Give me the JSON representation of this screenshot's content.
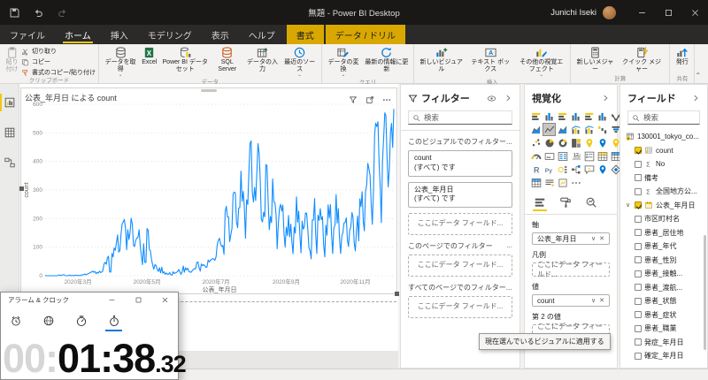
{
  "titlebar": {
    "title": "無題 - Power BI Desktop",
    "user_name": "Junichi Iseki"
  },
  "menu": {
    "tabs": [
      {
        "label": "ファイル"
      },
      {
        "label": "ホーム",
        "selected": true
      },
      {
        "label": "挿入"
      },
      {
        "label": "モデリング"
      },
      {
        "label": "表示"
      },
      {
        "label": "ヘルプ"
      },
      {
        "label": "書式",
        "contextual": true
      },
      {
        "label": "データ / ドリル",
        "contextual": true
      }
    ]
  },
  "ribbon": {
    "groups": [
      {
        "label": "クリップボード",
        "items": [
          {
            "label": "貼り付け",
            "icon": "paste",
            "size": "large",
            "disabled": true
          },
          {
            "label": "切り取り",
            "icon": "scissors",
            "size": "small"
          },
          {
            "label": "コピー",
            "icon": "copy",
            "size": "small"
          },
          {
            "label": "書式のコピー/貼り付け",
            "icon": "painter",
            "size": "small"
          }
        ]
      },
      {
        "label": "データ",
        "items": [
          {
            "label": "データを取得",
            "icon": "get-data",
            "size": "large",
            "dropdown": true
          },
          {
            "label": "Excel",
            "icon": "excel",
            "size": "large"
          },
          {
            "label": "Power BI データセット",
            "icon": "pbi-dataset",
            "size": "large"
          },
          {
            "label": "SQL Server",
            "icon": "sql-server",
            "size": "large"
          },
          {
            "label": "データの入力",
            "icon": "enter-data",
            "size": "large"
          },
          {
            "label": "最近のソース",
            "icon": "recent-sources",
            "size": "large",
            "dropdown": true
          }
        ]
      },
      {
        "label": "クエリ",
        "items": [
          {
            "label": "データの変換",
            "icon": "transform-data",
            "size": "large",
            "dropdown": true
          },
          {
            "label": "最新の情報に更新",
            "icon": "refresh",
            "size": "large"
          }
        ]
      },
      {
        "label": "挿入",
        "items": [
          {
            "label": "新しいビジュアル",
            "icon": "new-visual",
            "size": "large"
          },
          {
            "label": "テキスト ボックス",
            "icon": "text-box",
            "size": "large"
          },
          {
            "label": "その他の視覚エフェクト",
            "icon": "more-visuals",
            "size": "large",
            "dropdown": true
          }
        ]
      },
      {
        "label": "計算",
        "items": [
          {
            "label": "新しいメジャー",
            "icon": "new-measure",
            "size": "large"
          },
          {
            "label": "クイック メジャー",
            "icon": "quick-measure",
            "size": "large"
          }
        ]
      },
      {
        "label": "共有",
        "items": [
          {
            "label": "発行",
            "icon": "publish",
            "size": "large"
          }
        ]
      }
    ]
  },
  "view_sidebar": {
    "views": [
      {
        "name": "report-view",
        "selected": true
      },
      {
        "name": "data-view"
      },
      {
        "name": "model-view"
      }
    ]
  },
  "visual": {
    "title": "公表_年月日 による count"
  },
  "chart_data": {
    "type": "line",
    "title": "公表_年月日 による count",
    "xlabel": "公表_年月日",
    "ylabel": "count",
    "ylim": [
      0,
      600
    ],
    "y_ticks": [
      0,
      100,
      200,
      300,
      400,
      500,
      600
    ],
    "grid": "dotted-horizontal",
    "legend": "none",
    "start_date": "2020-02-01",
    "x_ticks": [
      {
        "day": 29,
        "label": "2020年3月"
      },
      {
        "day": 90,
        "label": "2020年5月"
      },
      {
        "day": 151,
        "label": "2020年7月"
      },
      {
        "day": 213,
        "label": "2020年9月"
      },
      {
        "day": 274,
        "label": "2020年11月"
      }
    ],
    "series": [
      {
        "name": "count",
        "color": "#118DFF",
        "values": [
          1,
          0,
          0,
          0,
          0,
          0,
          0,
          0,
          0,
          0,
          0,
          0,
          3,
          2,
          0,
          3,
          3,
          3,
          0,
          0,
          0,
          1,
          2,
          0,
          1,
          1,
          0,
          2,
          1,
          1,
          1,
          0,
          3,
          2,
          4,
          6,
          3,
          5,
          7,
          9,
          11,
          13,
          16,
          12,
          15,
          7,
          12,
          9,
          16,
          11,
          13,
          17,
          41,
          47,
          40,
          63,
          68,
          13,
          13,
          78,
          66,
          97,
          89,
          116,
          143,
          83,
          87,
          144,
          181,
          189,
          197,
          166,
          91,
          161,
          127,
          149,
          201,
          181,
          107,
          102,
          123,
          132,
          134,
          161,
          103,
          72,
          39,
          112,
          47,
          46,
          165,
          160,
          93,
          87,
          57,
          38,
          23,
          39,
          36,
          22,
          15,
          28,
          10,
          30,
          9,
          14,
          5,
          10,
          5,
          5,
          11,
          3,
          2,
          14,
          8,
          10,
          11,
          15,
          22,
          14,
          5,
          13,
          34,
          12,
          28,
          20,
          26,
          14,
          13,
          12,
          18,
          22,
          25,
          24,
          47,
          48,
          27,
          16,
          41,
          35,
          39,
          35,
          29,
          31,
          55,
          48,
          54,
          57,
          60,
          58,
          54,
          67,
          107,
          124,
          131,
          111,
          102,
          106,
          75,
          224,
          243,
          206,
          206,
          119,
          143,
          165,
          286,
          293,
          290,
          188,
          168,
          237,
          238,
          366,
          260,
          295,
          239,
          131,
          266,
          250,
          367,
          463,
          472,
          292,
          258,
          309,
          263,
          360,
          462,
          429,
          331,
          197,
          188,
          222,
          206,
          389,
          385,
          260,
          161,
          207,
          186,
          339,
          258,
          256,
          212,
          95,
          182,
          236,
          250,
          226,
          247,
          148,
          100,
          170,
          141,
          211,
          136,
          181,
          116,
          77,
          170,
          149,
          276,
          187,
          226,
          146,
          80,
          191,
          163,
          171,
          220,
          218,
          162,
          98,
          88,
          59,
          195,
          195,
          270,
          144,
          78,
          212,
          194,
          235,
          196,
          207,
          108,
          66,
          177,
          142,
          248,
          203,
          249,
          146,
          78,
          166,
          177,
          284,
          184,
          235,
          132,
          78,
          139,
          150,
          185,
          186,
          203,
          124,
          102,
          158,
          171,
          221,
          204,
          116,
          87,
          158,
          209,
          122,
          269,
          242,
          294,
          189,
          157,
          293,
          317,
          393,
          374,
          352,
          255,
          180,
          298,
          493,
          534,
          522,
          539,
          391,
          314,
          186,
          401,
          481,
          570,
          561,
          418,
          311,
          372,
          500,
          533,
          449,
          584
        ]
      }
    ]
  },
  "filters": {
    "header": "フィルター",
    "search_placeholder": "検索",
    "sections": [
      {
        "title": "このビジュアルでのフィルター...",
        "cards": [
          {
            "name": "count",
            "condition": "(すべて) です"
          },
          {
            "name": "公表_年月日",
            "condition": "(すべて) です"
          },
          {
            "placeholder": "ここにデータ フィールド..."
          }
        ]
      },
      {
        "title": "このページでのフィルター",
        "more": "...",
        "cards": [
          {
            "placeholder": "ここにデータ フィールド..."
          }
        ]
      },
      {
        "title": "すべてのページでのフィルター...",
        "cards": [
          {
            "placeholder": "ここにデータ フィールド..."
          }
        ]
      }
    ]
  },
  "visualizations": {
    "header": "視覚化",
    "icons": [
      {
        "name": "stacked-bar-chart"
      },
      {
        "name": "stacked-column-chart"
      },
      {
        "name": "clustered-bar-chart"
      },
      {
        "name": "clustered-column-chart"
      },
      {
        "name": "100-stacked-bar-chart"
      },
      {
        "name": "100-stacked-column-chart"
      },
      {
        "name": "ribbon-chart"
      },
      {
        "name": "area-chart"
      },
      {
        "name": "line-chart",
        "selected": true
      },
      {
        "name": "stacked-area-chart"
      },
      {
        "name": "line-and-stacked-column-chart"
      },
      {
        "name": "line-and-clustered-column-chart"
      },
      {
        "name": "waterfall-chart"
      },
      {
        "name": "funnel-chart"
      },
      {
        "name": "scatter-chart"
      },
      {
        "name": "pie-chart"
      },
      {
        "name": "donut-chart"
      },
      {
        "name": "treemap"
      },
      {
        "name": "map"
      },
      {
        "name": "filled-map"
      },
      {
        "name": "shape-map"
      },
      {
        "name": "gauge"
      },
      {
        "name": "card"
      },
      {
        "name": "multi-row-card"
      },
      {
        "name": "kpi"
      },
      {
        "name": "slicer"
      },
      {
        "name": "table"
      },
      {
        "name": "matrix"
      },
      {
        "name": "r-script-visual"
      },
      {
        "name": "python-visual"
      },
      {
        "name": "key-influencers"
      },
      {
        "name": "decomposition-tree"
      },
      {
        "name": "qa-visual"
      },
      {
        "name": "arcgis-map"
      },
      {
        "name": "power-apps"
      },
      {
        "name": "paginated-report"
      },
      {
        "name": "smart-narrative"
      },
      {
        "name": "custom-visual"
      },
      {
        "name": "more-visuals-ellipsis"
      }
    ],
    "tabs": [
      {
        "name": "fields-tab",
        "selected": true
      },
      {
        "name": "format-tab"
      },
      {
        "name": "analytics-tab"
      }
    ],
    "wells": [
      {
        "label": "軸",
        "value": "公表_年月日"
      },
      {
        "label": "凡例",
        "placeholder": "ここにデータ フィールド..."
      },
      {
        "label": "値",
        "value": "count"
      },
      {
        "label": "第 2 の値",
        "placeholder": "ここにデータ フィールド..."
      }
    ]
  },
  "fields_pane": {
    "header": "フィールド",
    "search_placeholder": "検索",
    "table": {
      "name": "130001_tokyo_co...",
      "icon": "table-check"
    },
    "fields": [
      {
        "name": "count",
        "checked": true,
        "icon": "grid"
      },
      {
        "name": "No",
        "icon": "sigma"
      },
      {
        "name": "備考"
      },
      {
        "name": "全国地方公...",
        "icon": "sigma"
      },
      {
        "name": "公表_年月日",
        "checked": true,
        "icon": "calendar",
        "expandable": true
      },
      {
        "name": "市区町村名"
      },
      {
        "name": "患者_居住地"
      },
      {
        "name": "患者_年代"
      },
      {
        "name": "患者_性別"
      },
      {
        "name": "患者_接触..."
      },
      {
        "name": "患者_渡航..."
      },
      {
        "name": "患者_状態"
      },
      {
        "name": "患者_症状"
      },
      {
        "name": "患者_職業"
      },
      {
        "name": "発症_年月日"
      },
      {
        "name": "確定_年月日"
      }
    ]
  },
  "tooltip_text": "現在選んでいるビジュアルに適用する",
  "alarm": {
    "title": "アラーム & クロック",
    "tabs": [
      {
        "name": "alarm-tab",
        "icon": "alarm"
      },
      {
        "name": "world-clock-tab",
        "icon": "world-clock"
      },
      {
        "name": "timer-tab",
        "icon": "timer"
      },
      {
        "name": "stopwatch-tab",
        "icon": "stopwatch",
        "selected": true
      }
    ],
    "stopwatch": {
      "hours": "00",
      "minutes": "01",
      "seconds": "38",
      "centiseconds": "32"
    },
    "display_gray": "00:",
    "display_main": "01:38",
    "display_frac": ".32"
  },
  "colors": {
    "accent_yellow": "#F2C811",
    "line_blue": "#118DFF",
    "stopwatch_blue": "#0078D7",
    "titlebar_dark": "#191817"
  }
}
